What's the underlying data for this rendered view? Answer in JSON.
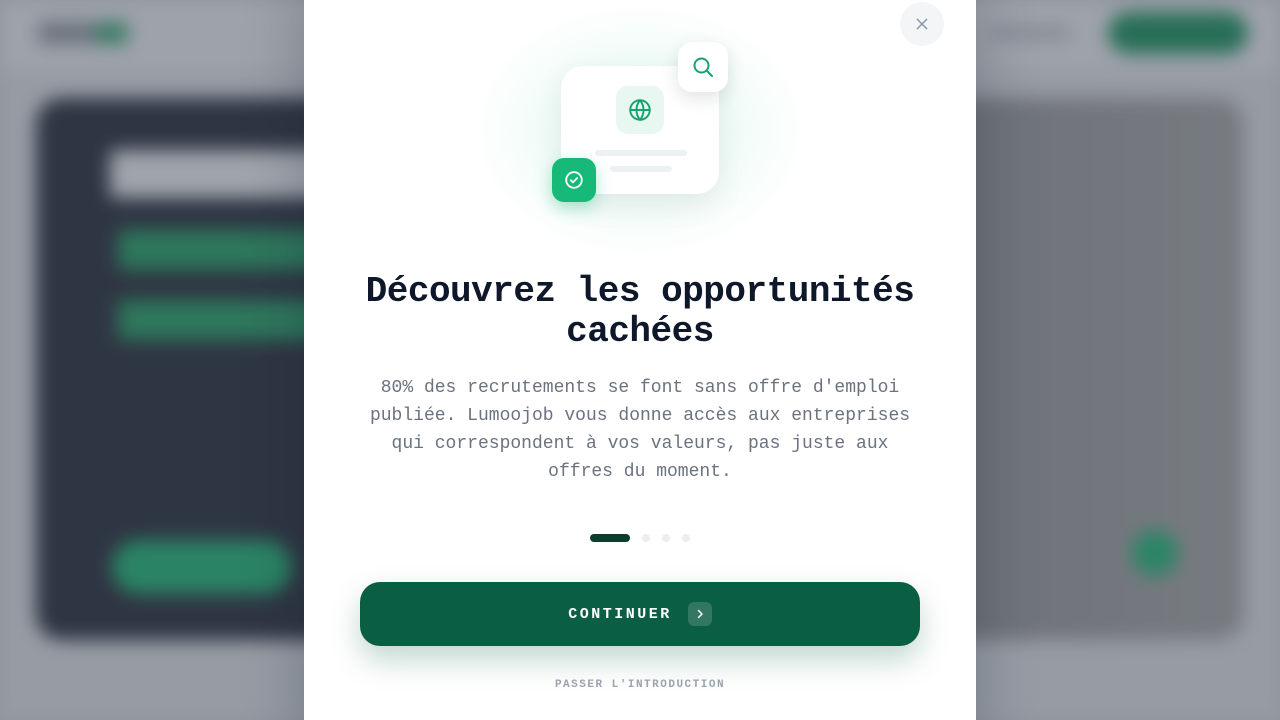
{
  "onboarding": {
    "title": "Découvrez les opportunités cachées",
    "description": "80% des recrutements se font sans offre d'emploi publiée. Lumoojob vous donne accès aux entreprises qui correspondent à vos valeurs, pas juste aux offres du moment.",
    "continue_label": "CONTINUER",
    "skip_label": "PASSER L'INTRODUCTION",
    "steps": {
      "total": 4,
      "current": 1
    },
    "icons": [
      "close-icon",
      "search-icon",
      "globe-icon",
      "check-circle-icon",
      "chevron-right-icon"
    ]
  },
  "colors": {
    "primary": "#0A5E44",
    "accent": "#16B978",
    "title": "#0F172A",
    "text_muted": "#6B7280"
  }
}
